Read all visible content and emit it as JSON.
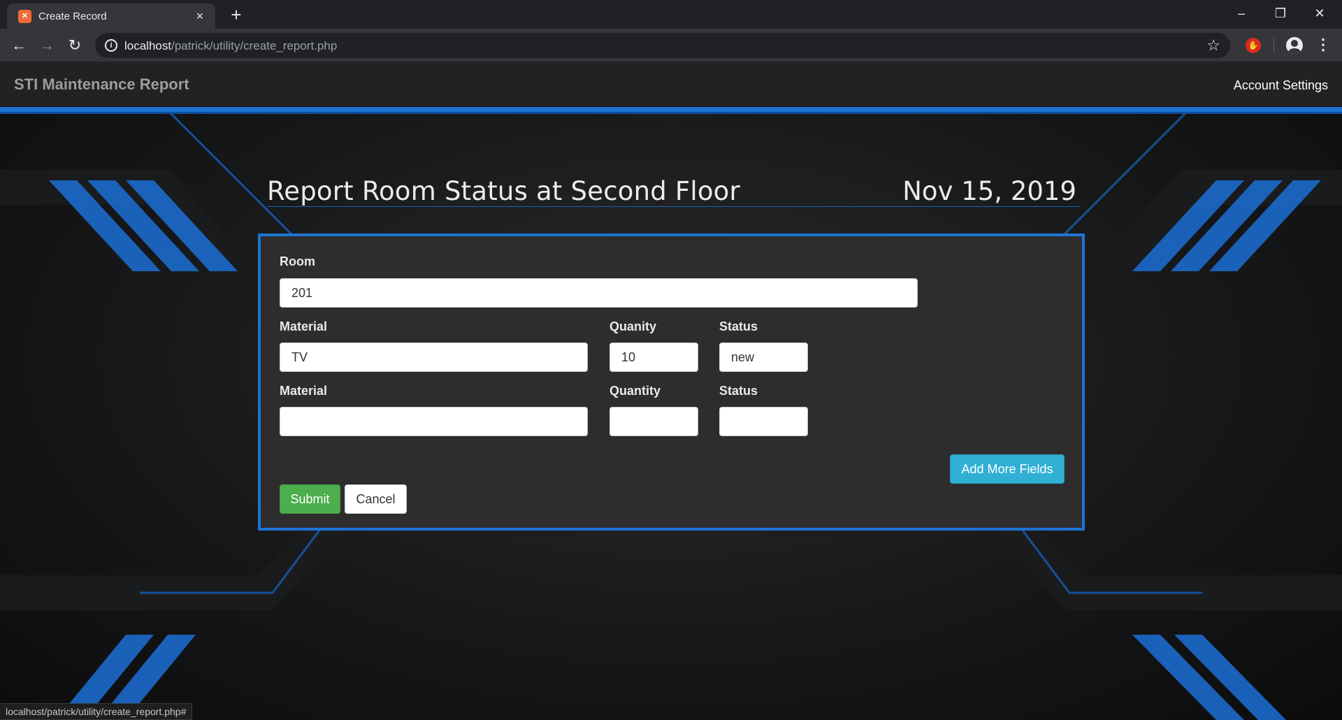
{
  "browser": {
    "tab_title": "Create Record",
    "tab_favicon": "xampp-icon",
    "tab_close": "×",
    "new_tab": "+",
    "url_host": "localhost",
    "url_path": "/patrick/utility/create_report.php",
    "window_min": "–",
    "window_max": "❐",
    "window_close": "✕"
  },
  "navbar": {
    "brand": "STI Maintenance Report",
    "account": "Account Settings"
  },
  "page": {
    "title": "Report Room Status at Second Floor",
    "date": "Nov 15, 2019"
  },
  "form": {
    "room_label": "Room",
    "room_value": "201",
    "rows": [
      {
        "material_label": "Material",
        "material_value": "TV",
        "quantity_label": "Quanity",
        "quantity_value": "10",
        "status_label": "Status",
        "status_value": "new"
      },
      {
        "material_label": "Material",
        "material_value": "",
        "quantity_label": "Quantity",
        "quantity_value": "",
        "status_label": "Status",
        "status_value": ""
      }
    ],
    "add_more_label": "Add More Fields",
    "submit_label": "Submit",
    "cancel_label": "Cancel"
  },
  "status_bar": "localhost/patrick/utility/create_report.php#",
  "colors": {
    "accent_blue": "#1e73d2",
    "submit_green": "#4cae4c",
    "info_blue": "#31b0d5",
    "panel_bg": "#2d2d2e"
  }
}
